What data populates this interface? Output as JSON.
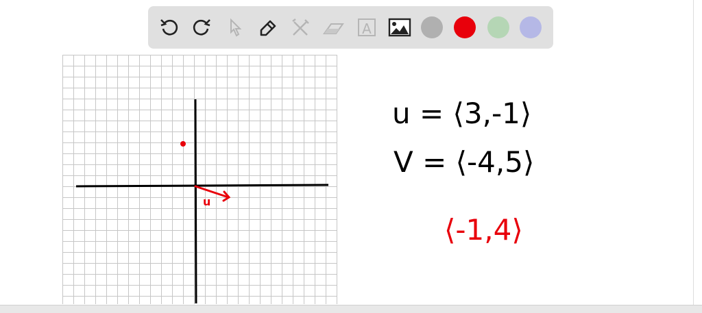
{
  "toolbar": {
    "tools": [
      {
        "name": "undo",
        "icon": "undo-icon",
        "enabled": true
      },
      {
        "name": "redo",
        "icon": "redo-icon",
        "enabled": true
      },
      {
        "name": "select",
        "icon": "pointer-icon",
        "enabled": false
      },
      {
        "name": "pen",
        "icon": "pencil-icon",
        "enabled": true
      },
      {
        "name": "tools",
        "icon": "tools-icon",
        "enabled": false
      },
      {
        "name": "eraser",
        "icon": "eraser-icon",
        "enabled": false
      },
      {
        "name": "text",
        "icon": "text-icon",
        "enabled": false
      },
      {
        "name": "image",
        "icon": "image-icon",
        "enabled": true
      }
    ],
    "text_tool_glyph": "A",
    "colors": [
      "#b0b0b0",
      "#e8000b",
      "#b5d6b5",
      "#b5b8e6"
    ],
    "selected_color": "#e8000b"
  },
  "board": {
    "vector_label": "u",
    "equations": [
      {
        "text": "u = ⟨3,-1⟩",
        "color": "#000000"
      },
      {
        "text": "V = ⟨-4,5⟩",
        "color": "#000000"
      },
      {
        "text": "⟨-1,4⟩",
        "color": "#e8000b"
      }
    ]
  }
}
